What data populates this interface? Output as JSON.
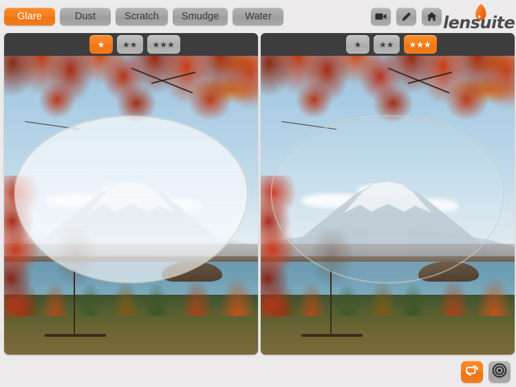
{
  "app": {
    "brand": "lensuite",
    "brand_mark": "lens-drop-icon",
    "accent_color": "#F5801F",
    "grey_color": "#A7A7A7",
    "panel_bg": "#3D3D3D",
    "page_bg": "#ECEAEA"
  },
  "toolbar": {
    "filters": [
      {
        "label": "Glare",
        "name": "tab-glare",
        "active": true
      },
      {
        "label": "Dust",
        "name": "tab-dust",
        "active": false
      },
      {
        "label": "Scratch",
        "name": "tab-scratch",
        "active": false
      },
      {
        "label": "Smudge",
        "name": "tab-smudge",
        "active": false
      },
      {
        "label": "Water",
        "name": "tab-water",
        "active": false
      }
    ],
    "tools": [
      {
        "icon": "video-camera-icon",
        "name": "video-button"
      },
      {
        "icon": "pencil-icon",
        "name": "edit-button"
      },
      {
        "icon": "home-icon",
        "name": "home-button"
      }
    ]
  },
  "panels": [
    {
      "name": "lens-preview-left",
      "side": "left",
      "selected_rating": 1,
      "glare_level": "strong",
      "ratings": [
        {
          "label": "★",
          "stars": 1,
          "active": true
        },
        {
          "label": "★★",
          "stars": 2,
          "active": false
        },
        {
          "label": "★★★",
          "stars": 3,
          "active": false
        }
      ]
    },
    {
      "name": "lens-preview-right",
      "side": "right",
      "selected_rating": 3,
      "glare_level": "weak",
      "ratings": [
        {
          "label": "★",
          "stars": 1,
          "active": false
        },
        {
          "label": "★★",
          "stars": 2,
          "active": false
        },
        {
          "label": "★★★",
          "stars": 3,
          "active": true
        }
      ]
    }
  ],
  "scene": {
    "description": "Mount Fuji over Lake Kawaguchi framed by red autumn maple leaves"
  },
  "bottom_bar": {
    "buttons": [
      {
        "icon": "rotate-screen-icon",
        "name": "rotate-view-button",
        "style": "orange"
      },
      {
        "icon": "target-icon",
        "name": "focus-target-button",
        "style": "grey"
      }
    ]
  }
}
